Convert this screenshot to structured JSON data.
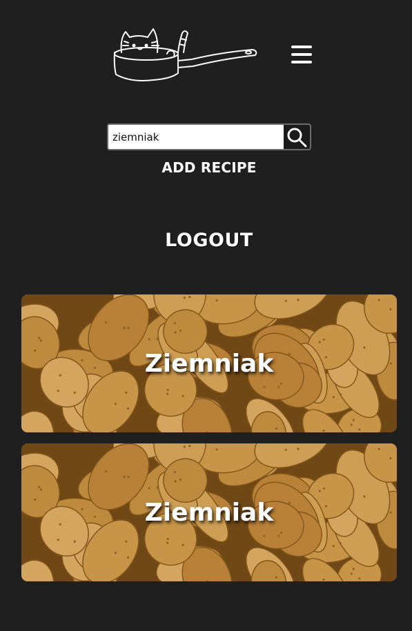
{
  "header": {
    "logo_icon": "cat-in-pot-logo",
    "menu_icon": "hamburger-menu-icon"
  },
  "search": {
    "value": "ziemniak",
    "placeholder": "",
    "button_icon": "search-icon"
  },
  "nav": {
    "add_recipe_label": "ADD RECIPE",
    "logout_label": "LOGOUT"
  },
  "recipes": [
    {
      "title": "Ziemniak",
      "image": "potatoes-photo"
    },
    {
      "title": "Ziemniak",
      "image": "potatoes-photo"
    }
  ],
  "colors": {
    "background": "#1f1f1f",
    "text": "#ffffff",
    "potato": "#d9a24f"
  }
}
